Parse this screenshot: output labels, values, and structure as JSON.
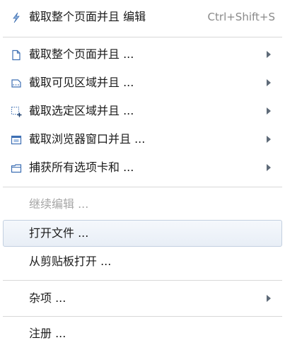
{
  "menu": {
    "items": [
      {
        "label": "截取整个页面并且 编辑",
        "shortcut": "Ctrl+Shift+S",
        "icon": "lightning-icon",
        "enabled": true,
        "submenu": false
      },
      {
        "label": "截取整个页面并且 ...",
        "icon": "page-icon",
        "enabled": true,
        "submenu": true
      },
      {
        "label": "截取可见区域并且 ...",
        "icon": "visible-area-icon",
        "enabled": true,
        "submenu": true
      },
      {
        "label": "截取选定区域并且 ...",
        "icon": "selection-icon",
        "enabled": true,
        "submenu": true
      },
      {
        "label": "截取浏览器窗口并且 ...",
        "icon": "browser-window-icon",
        "enabled": true,
        "submenu": true
      },
      {
        "label": "捕获所有选项卡和 ...",
        "icon": "tabs-icon",
        "enabled": true,
        "submenu": true
      },
      {
        "label": "继续编辑 ...",
        "enabled": false,
        "submenu": false
      },
      {
        "label": "打开文件 ...",
        "enabled": true,
        "submenu": false,
        "highlighted": true
      },
      {
        "label": "从剪贴板打开 ...",
        "enabled": true,
        "submenu": false
      },
      {
        "label": "杂项 ...",
        "enabled": true,
        "submenu": true
      },
      {
        "label": "注册 ...",
        "enabled": true,
        "submenu": false
      }
    ]
  },
  "colors": {
    "icon_blue": "#3d6fb3",
    "disabled_text": "#a6a6a6",
    "highlight_border": "#c3d0e0"
  }
}
